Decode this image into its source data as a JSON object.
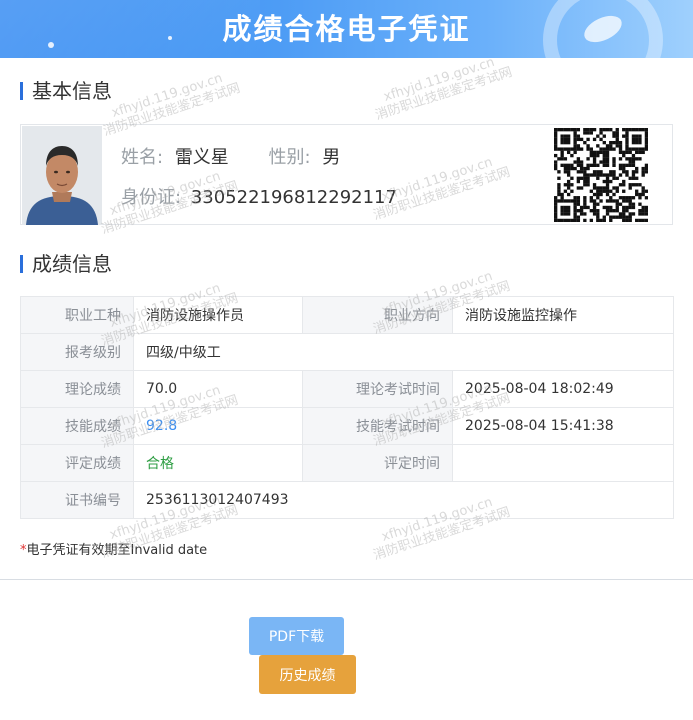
{
  "header": {
    "title": "成绩合格电子凭证"
  },
  "basic": {
    "section_title": "基本信息",
    "name_label": "姓名:",
    "name": "雷义星",
    "gender_label": "性别:",
    "gender": "男",
    "id_label": "身份证:",
    "id_number": "330522196812292117"
  },
  "score": {
    "section_title": "成绩信息",
    "rows": [
      {
        "l1": "职业工种",
        "v1": "消防设施操作员",
        "l2": "职业方向",
        "v2": "消防设施监控操作"
      },
      {
        "l1": "报考级别",
        "v1": "四级/中级工"
      },
      {
        "l1": "理论成绩",
        "v1": "70.0",
        "l2": "理论考试时间",
        "v2": "2025-08-04 18:02:49"
      },
      {
        "l1": "技能成绩",
        "v1": "92.8",
        "l2": "技能考试时间",
        "v2": "2025-08-04 15:41:38"
      },
      {
        "l1": "评定成绩",
        "v1": "合格",
        "l2": "评定时间",
        "v2": ""
      },
      {
        "l1": "证书编号",
        "v1": "2536113012407493"
      }
    ]
  },
  "note": {
    "star": "*",
    "text": "电子凭证有效期至Invalid date"
  },
  "buttons": {
    "pdf": "PDF下载",
    "history": "历史成绩"
  },
  "watermark": {
    "line1": "xfhyjd.119.gov.cn",
    "line2": "消防职业技能鉴定考试网"
  },
  "colors": {
    "accent": "#3a8ef2",
    "pass": "#2f9e44",
    "history_button": "#e6a23c",
    "pdf_button": "#7ab6f5"
  }
}
